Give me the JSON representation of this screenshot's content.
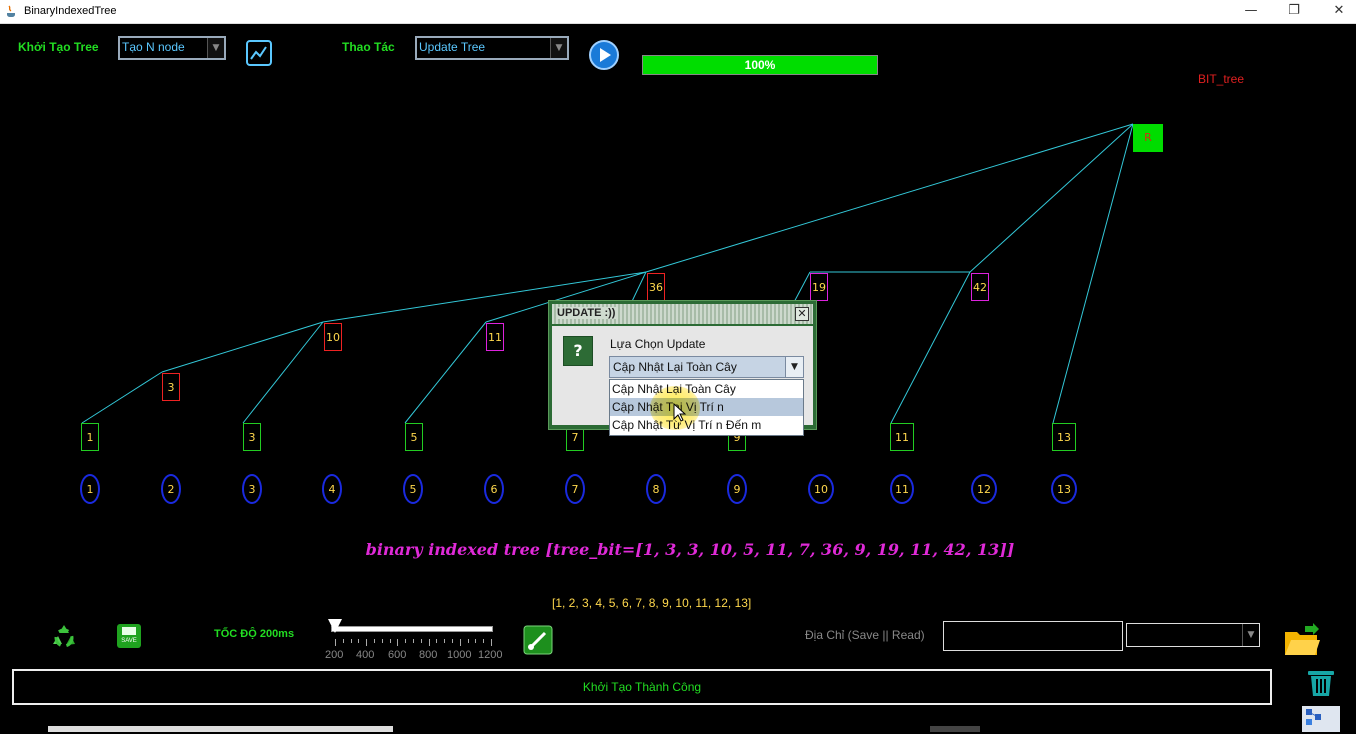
{
  "window": {
    "title": "BinaryIndexedTree",
    "minimize": "—",
    "restore": "❐",
    "close": "✕"
  },
  "toolbar": {
    "init_label": "Khởi Tạo Tree",
    "init_value": "Tạo N node",
    "action_label": "Thao Tác",
    "action_value": "Update Tree",
    "progress_text": "100%",
    "progress": 1.0
  },
  "tree": {
    "root_label": "BIT_tree",
    "root": "R",
    "internal": [
      "36",
      "19",
      "42",
      "10",
      "11",
      "3"
    ],
    "leaves": [
      "1",
      "3",
      "5",
      "7",
      "9",
      "11",
      "13"
    ],
    "indices": [
      "1",
      "2",
      "3",
      "4",
      "5",
      "6",
      "7",
      "8",
      "9",
      "10",
      "11",
      "12",
      "13"
    ]
  },
  "dialog": {
    "title": "UPDATE :))",
    "close": "✕",
    "question_icon": "?",
    "prompt": "Lựa Chọn Update",
    "selected": "Cập Nhật Lại Toàn Cây",
    "options": [
      "Cập Nhật Lại Toàn Cây",
      "Cập Nhật Tại Vị Trí n",
      "Cập Nhật Từ Vị Trí n Đến m"
    ],
    "highlighted_index": 1
  },
  "output": {
    "bit_text": "binary indexed tree [tree_bit=[1, 3, 3, 10, 5, 11, 7, 36, 9, 19, 11, 42, 13]]",
    "array_text": "[1, 2, 3, 4, 5, 6, 7, 8, 9, 10, 11, 12, 13]"
  },
  "controls": {
    "speed_label": "TỐC ĐỘ 200ms",
    "speed_value": 200,
    "slider_ticks": [
      "200",
      "400",
      "600",
      "800",
      "1000",
      "1200"
    ],
    "address_label": "Địa Chỉ (Save || Read)",
    "address_value": "",
    "save_caption": "SAVE"
  },
  "status": "Khởi Tạo Thành Công",
  "colors": {
    "accent_green": "#22dd22",
    "line_cyan": "#33c8d8",
    "number_yellow": "#ffd84d",
    "magenta": "#e02ad8"
  }
}
